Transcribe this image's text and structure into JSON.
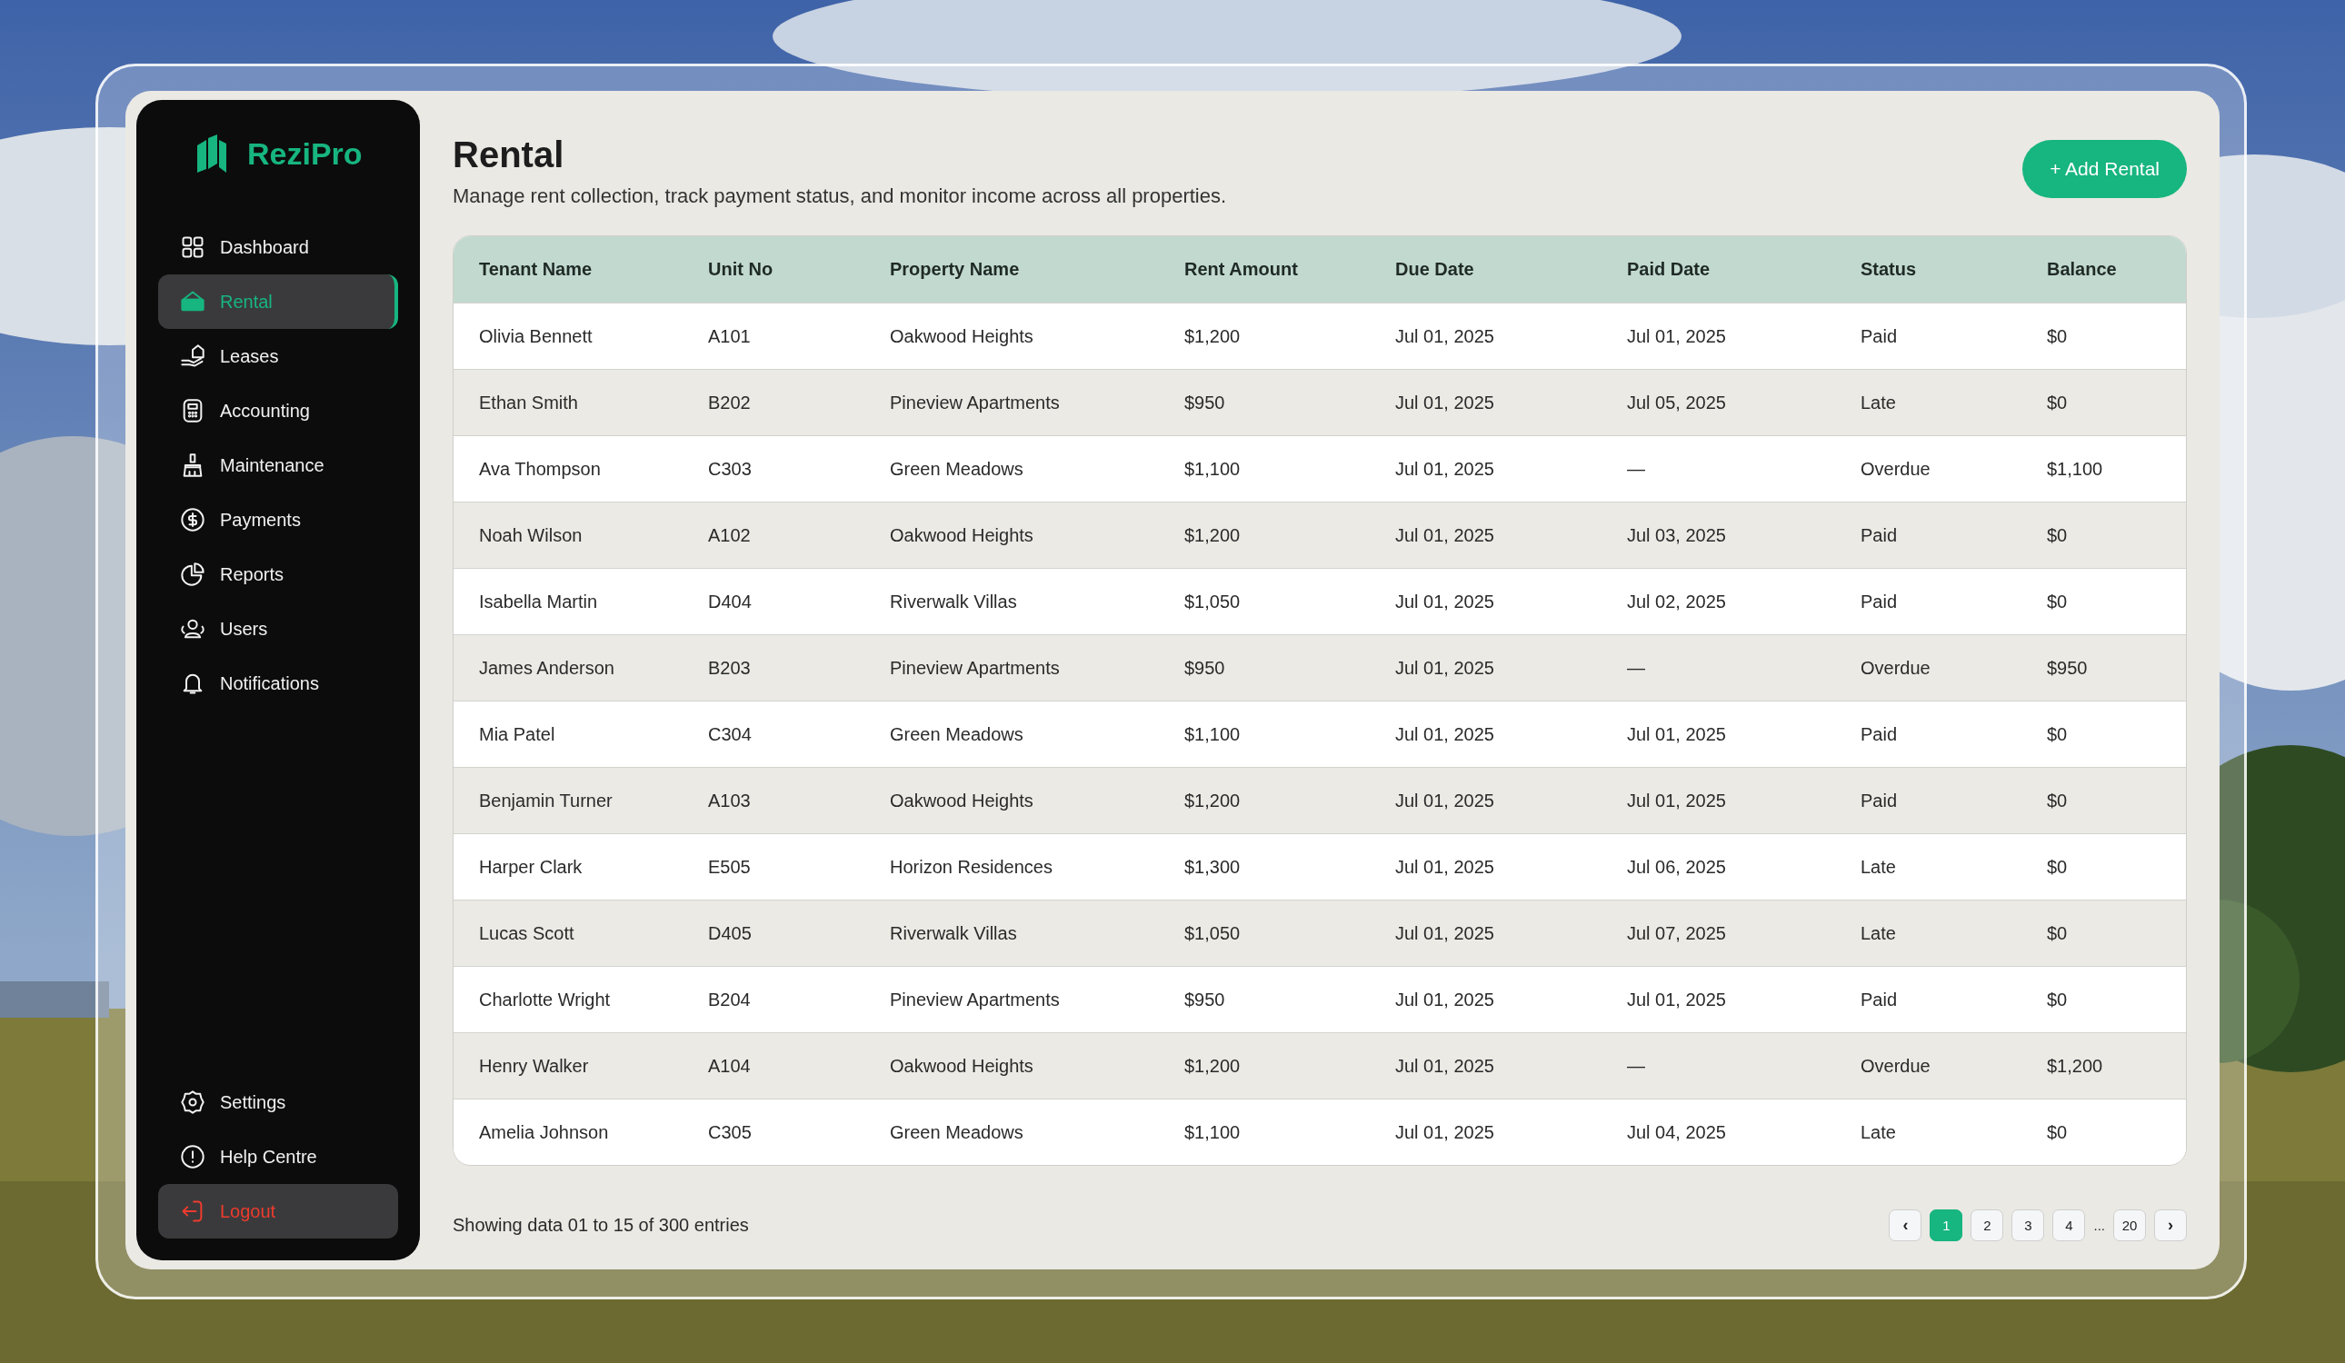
{
  "brand": {
    "name": "ReziPro"
  },
  "nav": [
    {
      "label": "Dashboard",
      "selected": false
    },
    {
      "label": "Rental",
      "selected": true
    },
    {
      "label": "Leases",
      "selected": false
    },
    {
      "label": "Accounting",
      "selected": false
    },
    {
      "label": "Maintenance",
      "selected": false
    },
    {
      "label": "Payments",
      "selected": false
    },
    {
      "label": "Reports",
      "selected": false
    },
    {
      "label": "Users",
      "selected": false
    },
    {
      "label": "Notifications",
      "selected": false
    }
  ],
  "bottom_nav": [
    {
      "label": "Settings",
      "kind": "link"
    },
    {
      "label": "Help Centre",
      "kind": "link"
    },
    {
      "label": "Logout",
      "kind": "logout"
    }
  ],
  "page": {
    "title": "Rental",
    "subtitle": "Manage rent collection, track payment status, and monitor income across all properties.",
    "add_button": "+ Add Rental"
  },
  "table": {
    "columns": [
      "Tenant Name",
      "Unit No",
      "Property Name",
      "Rent Amount",
      "Due Date",
      "Paid Date",
      "Status",
      "Balance"
    ],
    "rows": [
      [
        "Olivia Bennett",
        "A101",
        "Oakwood Heights",
        "$1,200",
        "Jul 01, 2025",
        "Jul 01, 2025",
        "Paid",
        "$0"
      ],
      [
        "Ethan Smith",
        "B202",
        "Pineview Apartments",
        "$950",
        "Jul 01, 2025",
        "Jul 05, 2025",
        "Late",
        "$0"
      ],
      [
        "Ava Thompson",
        "C303",
        "Green Meadows",
        "$1,100",
        "Jul 01, 2025",
        "—",
        "Overdue",
        "$1,100"
      ],
      [
        "Noah Wilson",
        "A102",
        "Oakwood Heights",
        "$1,200",
        "Jul 01, 2025",
        "Jul 03, 2025",
        "Paid",
        "$0"
      ],
      [
        "Isabella Martin",
        "D404",
        "Riverwalk Villas",
        "$1,050",
        "Jul 01, 2025",
        "Jul 02, 2025",
        "Paid",
        "$0"
      ],
      [
        "James Anderson",
        "B203",
        "Pineview Apartments",
        "$950",
        "Jul 01, 2025",
        "—",
        "Overdue",
        "$950"
      ],
      [
        "Mia Patel",
        "C304",
        "Green Meadows",
        "$1,100",
        "Jul 01, 2025",
        "Jul 01, 2025",
        "Paid",
        "$0"
      ],
      [
        "Benjamin Turner",
        "A103",
        "Oakwood Heights",
        "$1,200",
        "Jul 01, 2025",
        "Jul 01, 2025",
        "Paid",
        "$0"
      ],
      [
        "Harper Clark",
        "E505",
        "Horizon Residences",
        "$1,300",
        "Jul 01, 2025",
        "Jul 06, 2025",
        "Late",
        "$0"
      ],
      [
        "Lucas Scott",
        "D405",
        "Riverwalk Villas",
        "$1,050",
        "Jul 01, 2025",
        "Jul 07, 2025",
        "Late",
        "$0"
      ],
      [
        "Charlotte Wright",
        "B204",
        "Pineview Apartments",
        "$950",
        "Jul 01, 2025",
        "Jul 01, 2025",
        "Paid",
        "$0"
      ],
      [
        "Henry Walker",
        "A104",
        "Oakwood Heights",
        "$1,200",
        "Jul 01, 2025",
        "—",
        "Overdue",
        "$1,200"
      ],
      [
        "Amelia Johnson",
        "C305",
        "Green Meadows",
        "$1,100",
        "Jul 01, 2025",
        "Jul 04, 2025",
        "Late",
        "$0"
      ]
    ]
  },
  "footer": {
    "summary": "Showing data 01 to 15 of  300 entries"
  },
  "pagination": {
    "prev": "‹",
    "next": "›",
    "ellipsis": "...",
    "pages": [
      {
        "label": "1",
        "selected": true
      },
      {
        "label": "2",
        "selected": false
      },
      {
        "label": "3",
        "selected": false
      },
      {
        "label": "4",
        "selected": false
      },
      {
        "label": "20",
        "selected": false
      }
    ]
  }
}
